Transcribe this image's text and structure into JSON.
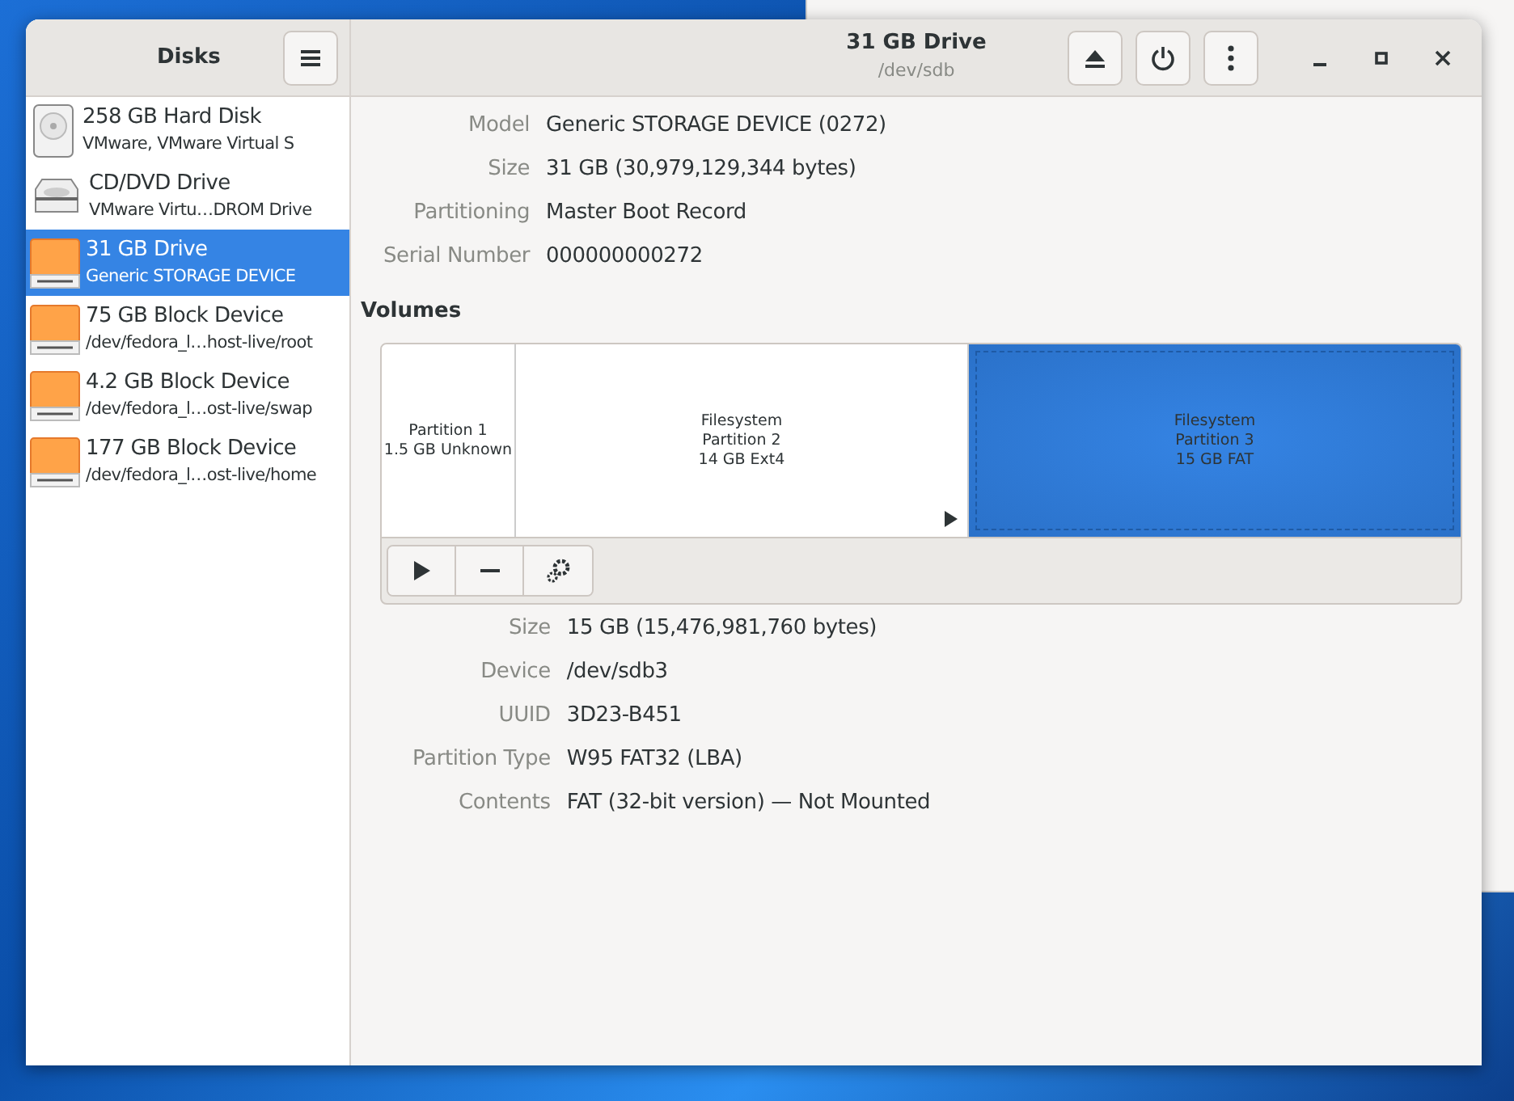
{
  "sidebar": {
    "title": "Disks",
    "devices": [
      {
        "kind": "hdd",
        "name": "258 GB Hard Disk",
        "detail": "VMware, VMware Virtual S",
        "selected": false
      },
      {
        "kind": "optical",
        "name": "CD/DVD Drive",
        "detail": "VMware Virtu…DROM Drive",
        "selected": false
      },
      {
        "kind": "drive",
        "name": "31 GB Drive",
        "detail": "Generic STORAGE DEVICE",
        "selected": true
      },
      {
        "kind": "drive",
        "name": "75 GB Block Device",
        "detail": "/dev/fedora_l…host-live/root",
        "selected": false
      },
      {
        "kind": "drive",
        "name": "4.2 GB Block Device",
        "detail": "/dev/fedora_l…ost-live/swap",
        "selected": false
      },
      {
        "kind": "drive",
        "name": "177 GB Block Device",
        "detail": "/dev/fedora_l…ost-live/home",
        "selected": false
      }
    ]
  },
  "header": {
    "title": "31 GB Drive",
    "subtitle": "/dev/sdb"
  },
  "drive_properties": [
    {
      "label": "Model",
      "value": "Generic STORAGE DEVICE (0272)"
    },
    {
      "label": "Size",
      "value": "31 GB (30,979,129,344 bytes)"
    },
    {
      "label": "Partitioning",
      "value": "Master Boot Record"
    },
    {
      "label": "Serial Number",
      "value": "000000000272"
    }
  ],
  "volumes": {
    "title": "Volumes",
    "partitions": [
      {
        "lines": [
          "Partition 1",
          "1.5 GB Unknown"
        ],
        "selected": false,
        "has_children": false
      },
      {
        "lines": [
          "Filesystem",
          "Partition 2",
          "14 GB Ext4"
        ],
        "selected": false,
        "has_children": true
      },
      {
        "lines": [
          "Filesystem",
          "Partition 3",
          "15 GB FAT"
        ],
        "selected": true,
        "has_children": false
      }
    ]
  },
  "volume_properties": [
    {
      "label": "Size",
      "value": "15 GB (15,476,981,760 bytes)"
    },
    {
      "label": "Device",
      "value": "/dev/sdb3"
    },
    {
      "label": "UUID",
      "value": "3D23-B451"
    },
    {
      "label": "Partition Type",
      "value": "W95 FAT32 (LBA)"
    },
    {
      "label": "Contents",
      "value": "FAT (32-bit version) — Not Mounted"
    }
  ]
}
